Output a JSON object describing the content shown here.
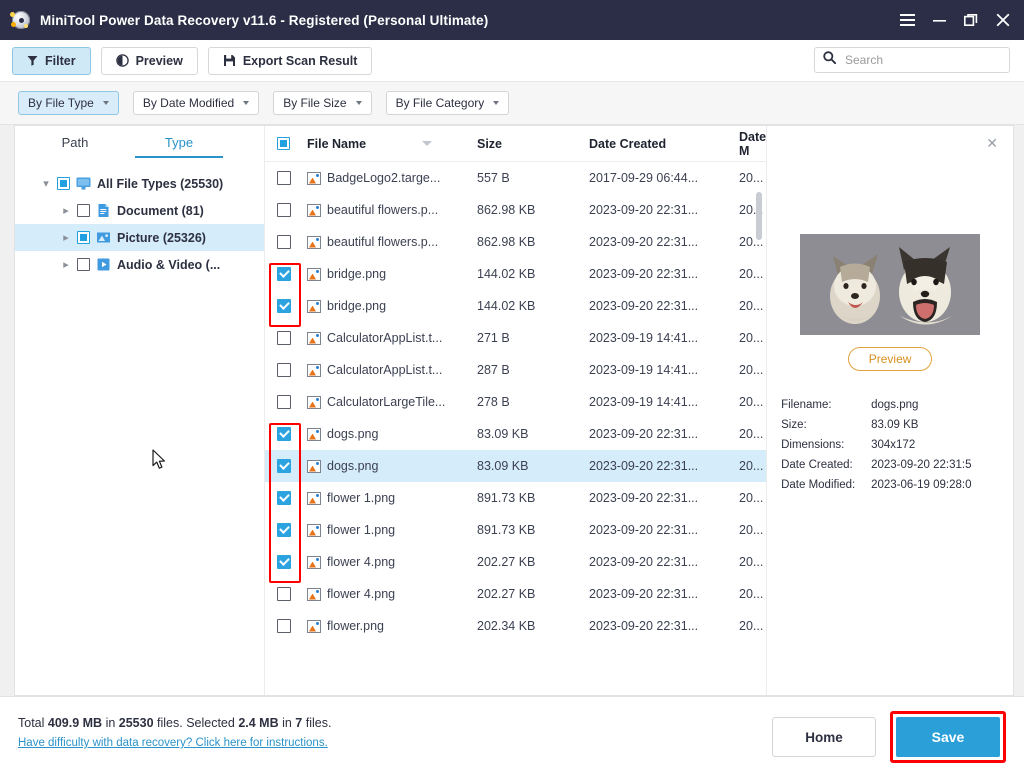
{
  "window": {
    "title": "MiniTool Power Data Recovery v11.6 - Registered (Personal Ultimate)",
    "app_icon": "disc-recovery-icon",
    "controls": [
      {
        "name": "menu-button",
        "glyph": "hamburger-icon"
      },
      {
        "name": "minimize-button",
        "glyph": "minimize-icon"
      },
      {
        "name": "restore-button",
        "glyph": "restore-icon"
      },
      {
        "name": "close-button",
        "glyph": "close-icon"
      }
    ]
  },
  "toolbar": {
    "filter_label": "Filter",
    "preview_label": "Preview",
    "export_label": "Export Scan Result"
  },
  "search": {
    "placeholder": "Search",
    "value": ""
  },
  "filters": [
    {
      "label": "By File Type",
      "active": true
    },
    {
      "label": "By Date Modified",
      "active": false
    },
    {
      "label": "By File Size",
      "active": false
    },
    {
      "label": "By File Category",
      "active": false
    }
  ],
  "tabs": [
    {
      "label": "Path",
      "active": false
    },
    {
      "label": "Type",
      "active": true
    }
  ],
  "tree": [
    {
      "label": "All File Types (25530)",
      "level": 0,
      "expanded": true,
      "check": "partial",
      "icon": "monitor-icon",
      "selected": false
    },
    {
      "label": "Document (81)",
      "level": 1,
      "expanded": false,
      "check": "unchecked",
      "icon": "document-icon",
      "selected": false
    },
    {
      "label": "Picture (25326)",
      "level": 1,
      "expanded": false,
      "check": "partial",
      "icon": "picture-icon",
      "selected": true
    },
    {
      "label": "Audio & Video (...",
      "level": 1,
      "expanded": false,
      "check": "unchecked",
      "icon": "media-icon",
      "selected": false
    }
  ],
  "table": {
    "columns": [
      "File Name",
      "Size",
      "Date Created",
      "Date M"
    ],
    "sort_column": "File Name",
    "header_check": "partial",
    "rows": [
      {
        "checked": false,
        "name": "BadgeLogo2.targe...",
        "size": "557 B",
        "created": "2017-09-29 06:44...",
        "modified": "20...",
        "selected": false
      },
      {
        "checked": false,
        "name": "beautiful flowers.p...",
        "size": "862.98 KB",
        "created": "2023-09-20 22:31...",
        "modified": "20...",
        "selected": false
      },
      {
        "checked": false,
        "name": "beautiful flowers.p...",
        "size": "862.98 KB",
        "created": "2023-09-20 22:31...",
        "modified": "20...",
        "selected": false
      },
      {
        "checked": true,
        "name": "bridge.png",
        "size": "144.02 KB",
        "created": "2023-09-20 22:31...",
        "modified": "20...",
        "selected": false
      },
      {
        "checked": true,
        "name": "bridge.png",
        "size": "144.02 KB",
        "created": "2023-09-20 22:31...",
        "modified": "20...",
        "selected": false
      },
      {
        "checked": false,
        "name": "CalculatorAppList.t...",
        "size": "271 B",
        "created": "2023-09-19 14:41...",
        "modified": "20...",
        "selected": false
      },
      {
        "checked": false,
        "name": "CalculatorAppList.t...",
        "size": "287 B",
        "created": "2023-09-19 14:41...",
        "modified": "20...",
        "selected": false
      },
      {
        "checked": false,
        "name": "CalculatorLargeTile...",
        "size": "278 B",
        "created": "2023-09-19 14:41...",
        "modified": "20...",
        "selected": false
      },
      {
        "checked": true,
        "name": "dogs.png",
        "size": "83.09 KB",
        "created": "2023-09-20 22:31...",
        "modified": "20...",
        "selected": false
      },
      {
        "checked": true,
        "name": "dogs.png",
        "size": "83.09 KB",
        "created": "2023-09-20 22:31...",
        "modified": "20...",
        "selected": true
      },
      {
        "checked": true,
        "name": "flower 1.png",
        "size": "891.73 KB",
        "created": "2023-09-20 22:31...",
        "modified": "20...",
        "selected": false
      },
      {
        "checked": true,
        "name": "flower 1.png",
        "size": "891.73 KB",
        "created": "2023-09-20 22:31...",
        "modified": "20...",
        "selected": false
      },
      {
        "checked": true,
        "name": "flower 4.png",
        "size": "202.27 KB",
        "created": "2023-09-20 22:31...",
        "modified": "20...",
        "selected": false
      },
      {
        "checked": false,
        "name": "flower 4.png",
        "size": "202.27 KB",
        "created": "2023-09-20 22:31...",
        "modified": "20...",
        "selected": false
      },
      {
        "checked": false,
        "name": "flower.png",
        "size": "202.34 KB",
        "created": "2023-09-20 22:31...",
        "modified": "20...",
        "selected": false
      }
    ]
  },
  "preview": {
    "close_icon": "close-icon",
    "thumbnail_alt": "two-huskies-photo",
    "button_label": "Preview",
    "details": [
      {
        "key": "Filename:",
        "value": "dogs.png"
      },
      {
        "key": "Size:",
        "value": "83.09 KB"
      },
      {
        "key": "Dimensions:",
        "value": "304x172"
      },
      {
        "key": "Date Created:",
        "value": "2023-09-20 22:31:5"
      },
      {
        "key": "Date Modified:",
        "value": "2023-06-19 09:28:0"
      }
    ]
  },
  "footer": {
    "total_prefix": "Total ",
    "total_size": "409.9 MB",
    "total_mid": " in ",
    "total_count": "25530",
    "total_files": " files.  Selected ",
    "selected_size": "2.4 MB",
    "selected_mid": " in ",
    "selected_count": "7",
    "selected_files": " files.",
    "help_link": "Have difficulty with data recovery? Click here for instructions.",
    "home_label": "Home",
    "save_label": "Save"
  },
  "colors": {
    "titlebar": "#2b2e46",
    "accent": "#2a9fd8",
    "selection": "#d5ecfa",
    "annotation_red": "#ff0000",
    "preview_orange": "#d98f20"
  }
}
